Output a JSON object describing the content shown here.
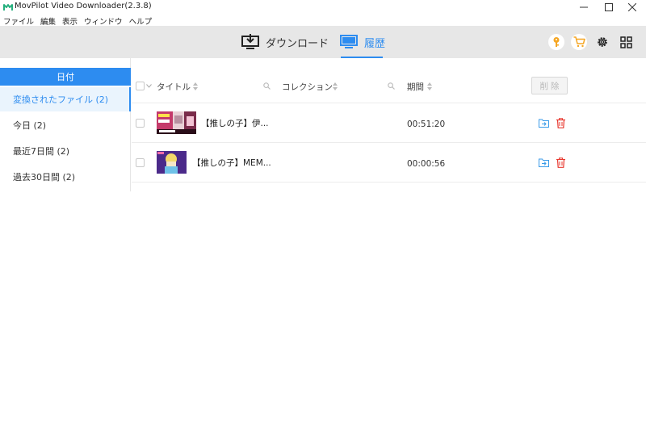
{
  "window": {
    "title": "MovPilot Video Downloader(2.3.8)",
    "minimize_icon": "minimize-icon",
    "maximize_icon": "maximize-icon",
    "close_icon": "close-icon"
  },
  "menu": {
    "items": [
      {
        "label": "ファイル"
      },
      {
        "label": "編集"
      },
      {
        "label": "表示"
      },
      {
        "label": "ウィンドウ"
      },
      {
        "label": "ヘルプ"
      }
    ]
  },
  "topnav": {
    "tabs": [
      {
        "label": "ダウンロード",
        "icon": "download-monitor-icon"
      },
      {
        "label": "履歴",
        "icon": "monitor-icon",
        "active": true
      }
    ],
    "tools": [
      {
        "icon": "key-icon"
      },
      {
        "icon": "cart-icon"
      },
      {
        "icon": "settings-icon"
      },
      {
        "icon": "grid-icon"
      }
    ]
  },
  "sidebar": {
    "header": "日付",
    "items": [
      {
        "label": "変換されたファイル (2)",
        "active": true
      },
      {
        "label": "今日 (2)"
      },
      {
        "label": "最近7日間 (2)"
      },
      {
        "label": "過去30日間 (2)"
      }
    ]
  },
  "table": {
    "columns": {
      "title": "タイトル",
      "collection": "コレクション",
      "duration": "期間"
    },
    "delete_button": "削除",
    "rows": [
      {
        "title": "【推しの子】伊...",
        "duration": "00:51:20"
      },
      {
        "title": "【推しの子】MEM...",
        "duration": "00:00:56"
      }
    ]
  },
  "colors": {
    "accent": "#2d8cf0",
    "nav_background": "#e7e7e7",
    "delete_red": "#e8382f",
    "folder_blue": "#3a9be8",
    "key_orange": "#f5a623"
  }
}
